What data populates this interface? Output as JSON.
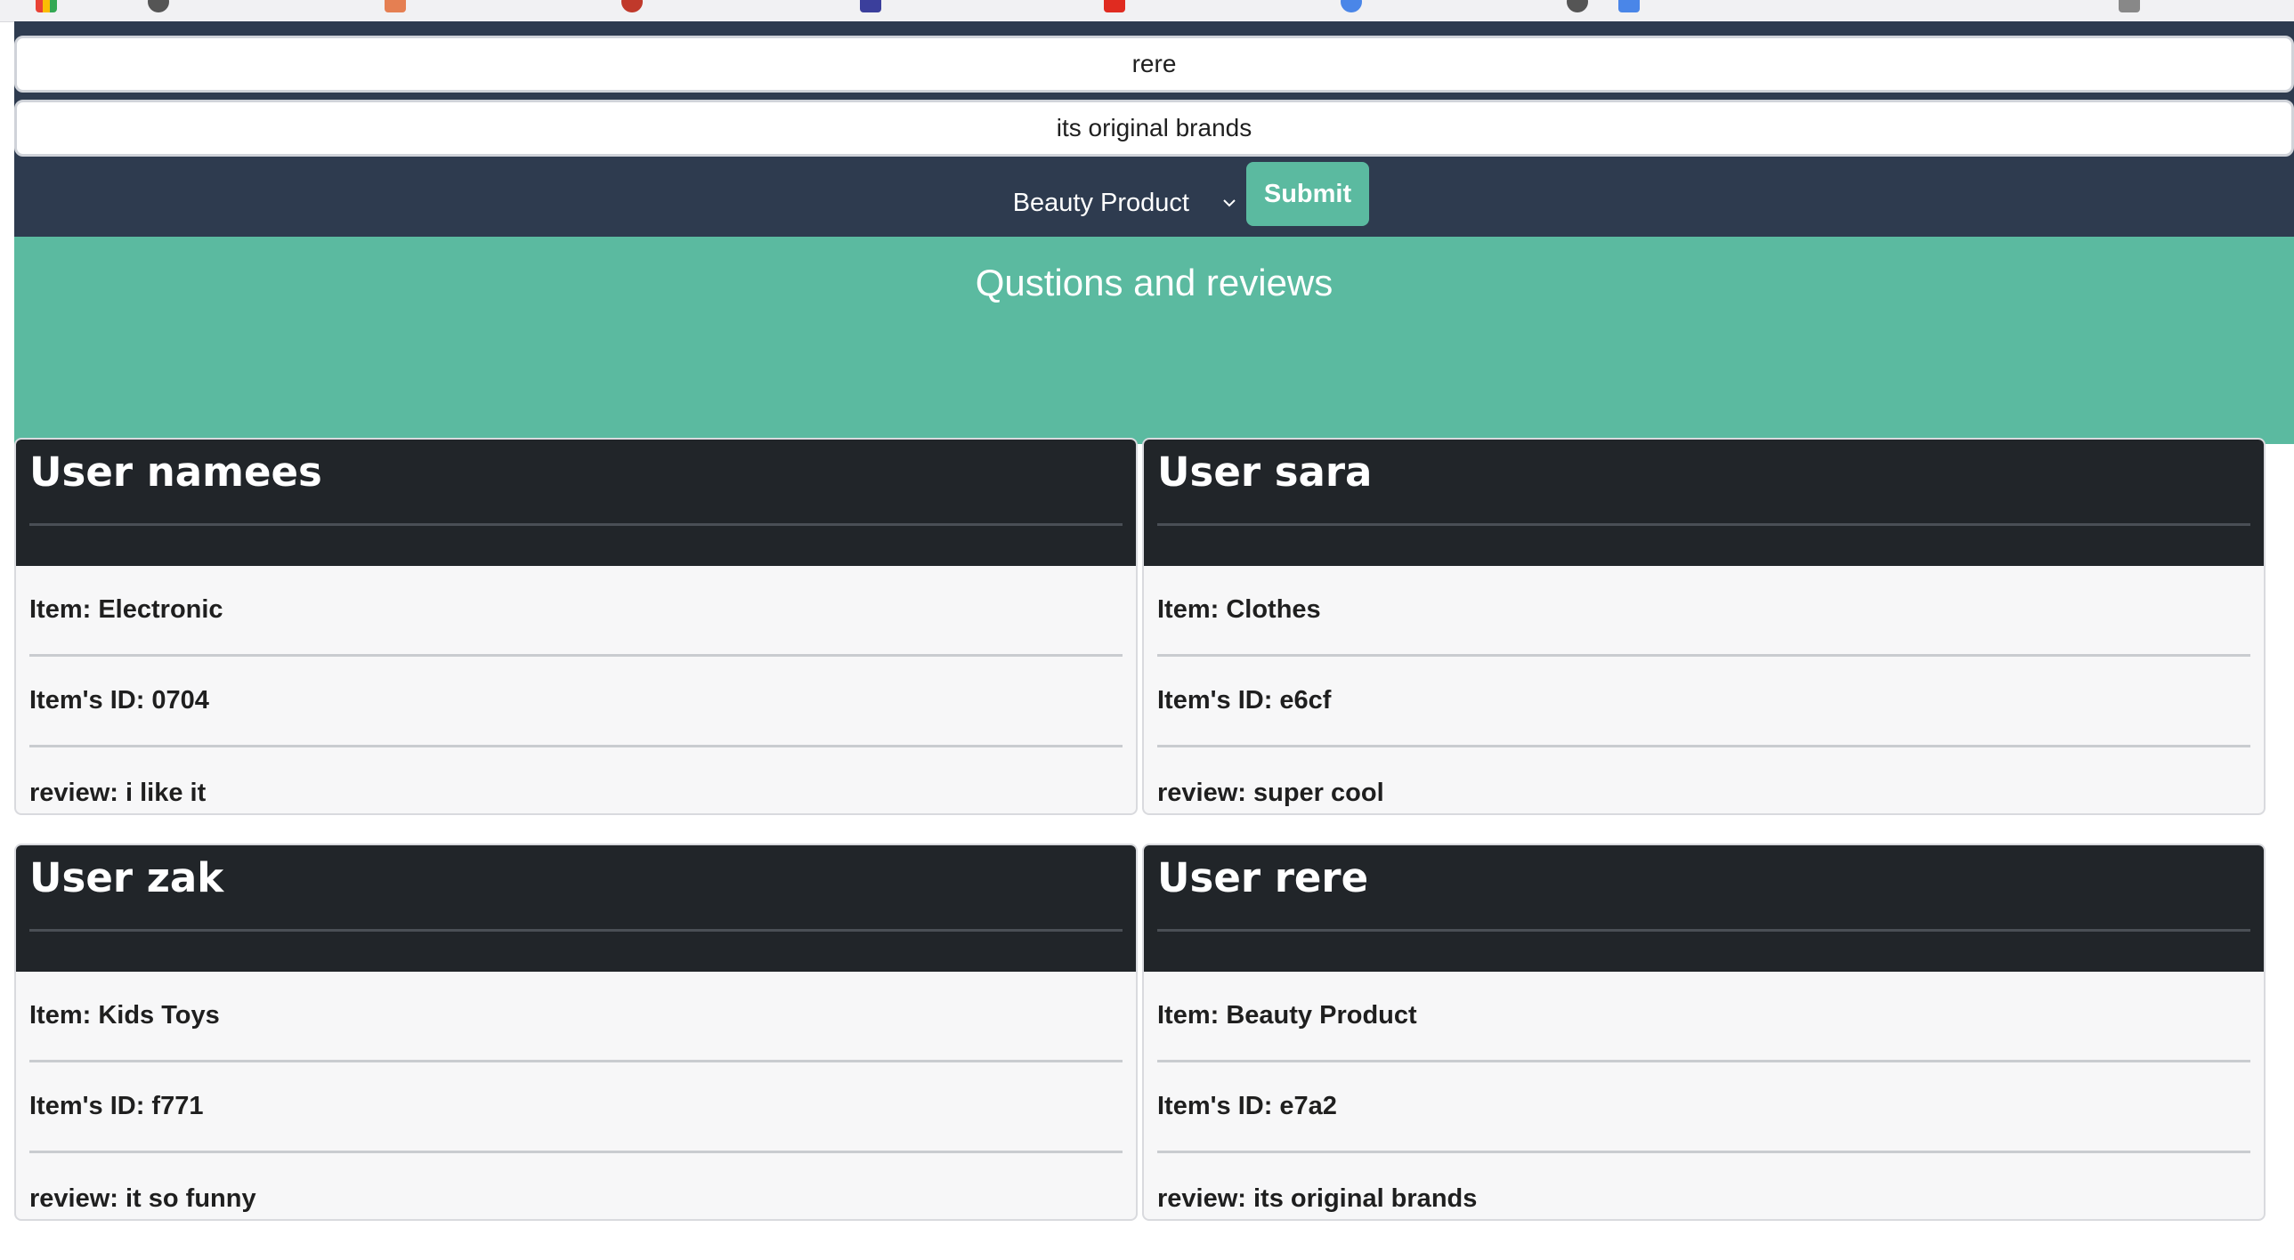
{
  "colors": {
    "nav_bg": "#2e3b4f",
    "accent_green": "#5bbaa0",
    "card_header_bg": "#212529",
    "card_body_bg": "#f7f7f8"
  },
  "form": {
    "user_value": "rere",
    "review_value": "its original brands",
    "category_selected": "Beauty Product",
    "submit_label": "Submit"
  },
  "hero": {
    "title": "Qustions and reviews"
  },
  "reviews": [
    {
      "title": "User namees",
      "item": "Item: Electronic",
      "item_id": "Item's ID: 0704",
      "review": "review: i like it"
    },
    {
      "title": "User sara",
      "item": "Item: Clothes",
      "item_id": "Item's ID: e6cf",
      "review": "review: super cool"
    },
    {
      "title": "User zak",
      "item": "Item: Kids Toys",
      "item_id": "Item's ID: f771",
      "review": "review: it so funny"
    },
    {
      "title": "User rere",
      "item": "Item: Beauty Product",
      "item_id": "Item's ID: e7a2",
      "review": "review: its original brands"
    }
  ]
}
